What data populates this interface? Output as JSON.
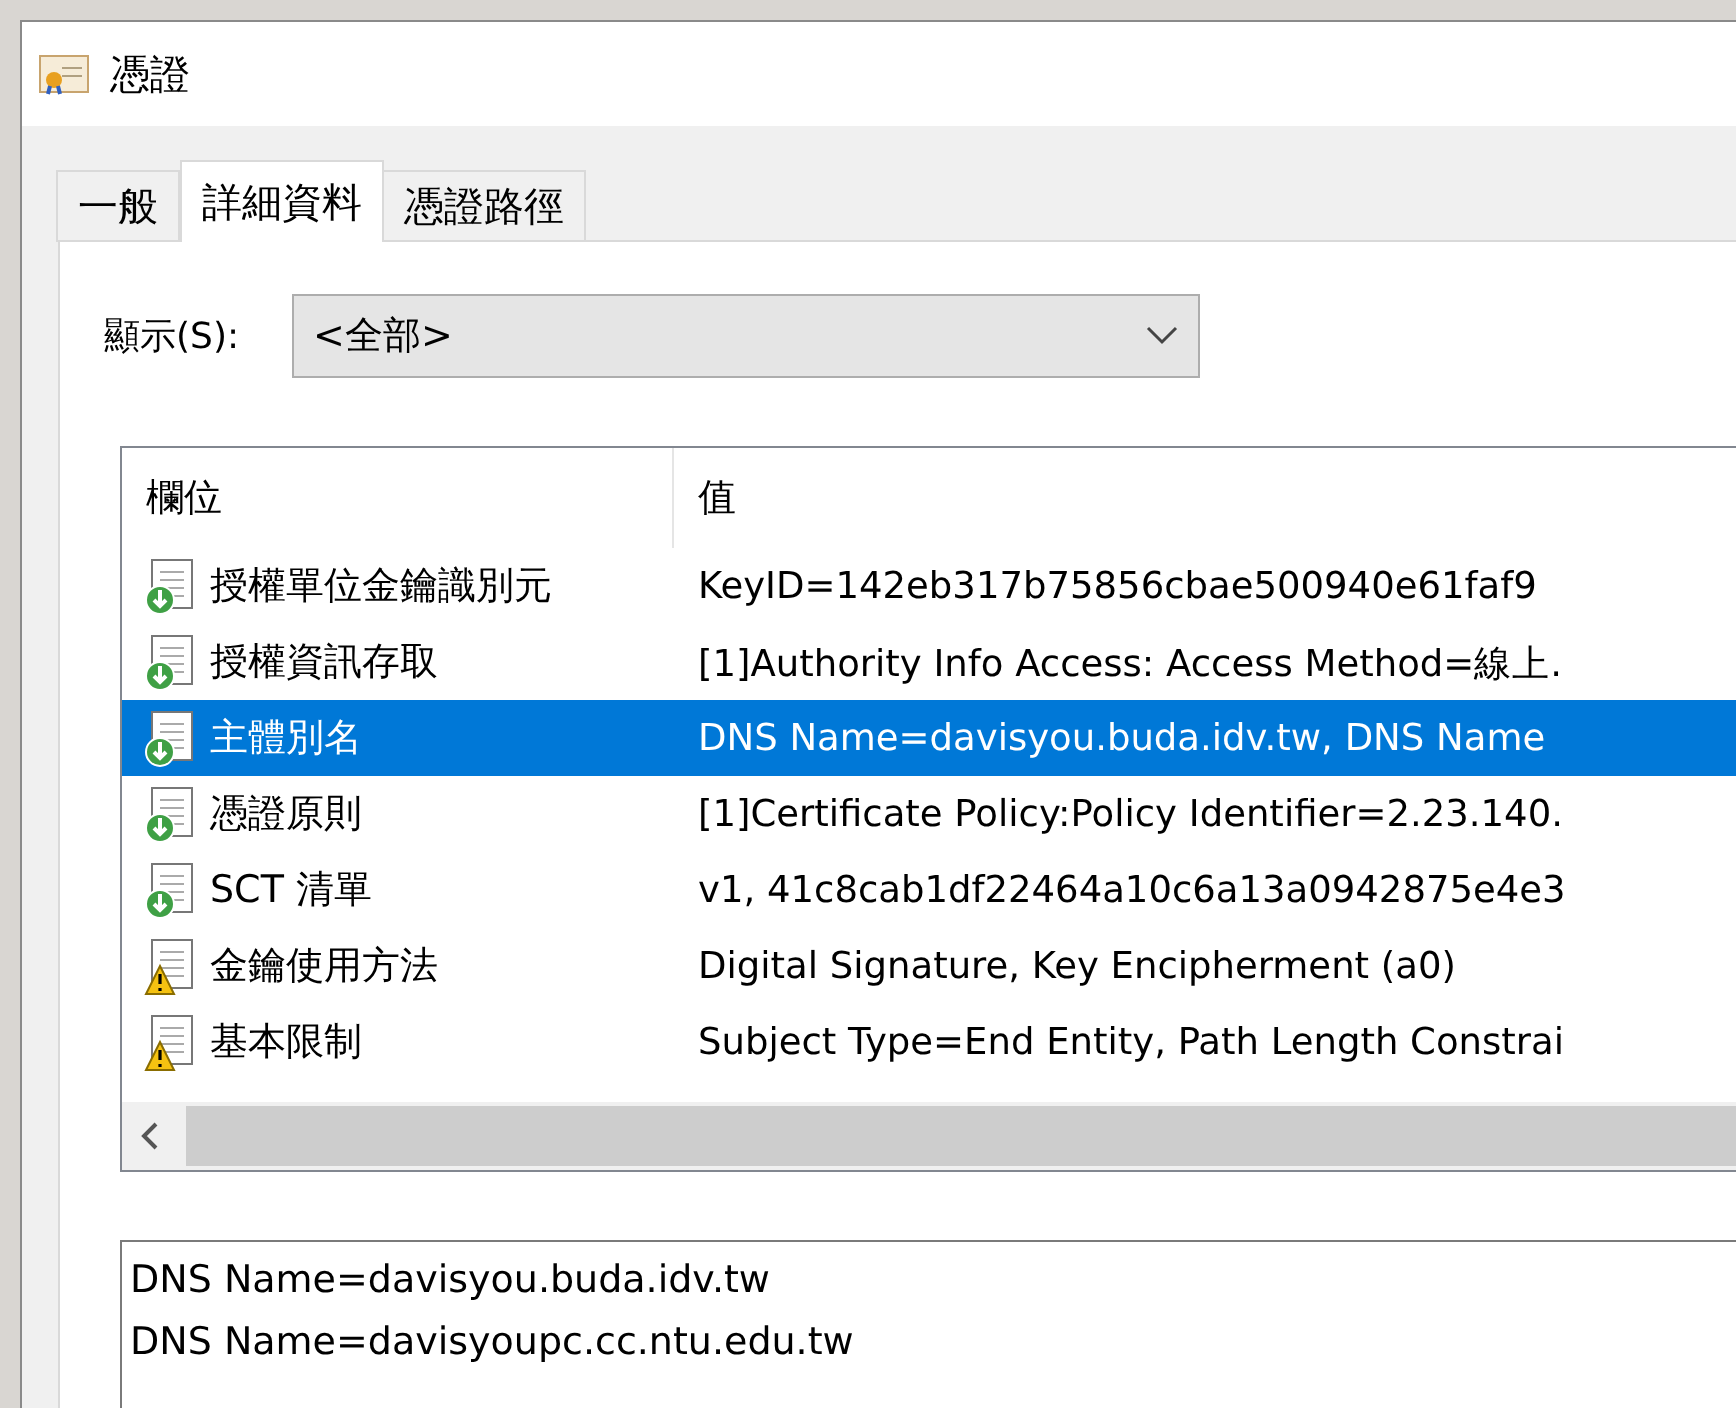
{
  "window": {
    "title": "憑證"
  },
  "tabs": [
    {
      "label": "一般",
      "selected": false
    },
    {
      "label": "詳細資料",
      "selected": true
    },
    {
      "label": "憑證路徑",
      "selected": false
    }
  ],
  "show": {
    "label": "顯示(S):",
    "value": "<全部>"
  },
  "table": {
    "columns": [
      "欄位",
      "值"
    ],
    "rows": [
      {
        "kind": "extension",
        "field": "授權單位金鑰識別元",
        "value": "KeyID=142eb317b75856cbae500940e61faf9",
        "selected": false
      },
      {
        "kind": "extension",
        "field": "授權資訊存取",
        "value": "[1]Authority Info Access: Access Method=線上.",
        "selected": false
      },
      {
        "kind": "extension",
        "field": "主體別名",
        "value": "DNS Name=davisyou.buda.idv.tw, DNS Name",
        "selected": true
      },
      {
        "kind": "extension",
        "field": "憑證原則",
        "value": "[1]Certificate Policy:Policy Identifier=2.23.140.",
        "selected": false
      },
      {
        "kind": "extension",
        "field": "SCT 清單",
        "value": "v1, 41c8cab1df22464a10c6a13a0942875e4e3",
        "selected": false
      },
      {
        "kind": "critical",
        "field": "金鑰使用方法",
        "value": "Digital Signature, Key Encipherment (a0)",
        "selected": false
      },
      {
        "kind": "critical",
        "field": "基本限制",
        "value": "Subject Type=End Entity, Path Length Constrai",
        "selected": false
      }
    ]
  },
  "detail": {
    "lines": [
      "DNS Name=davisyou.buda.idv.tw",
      "DNS Name=davisyoupc.cc.ntu.edu.tw"
    ]
  }
}
